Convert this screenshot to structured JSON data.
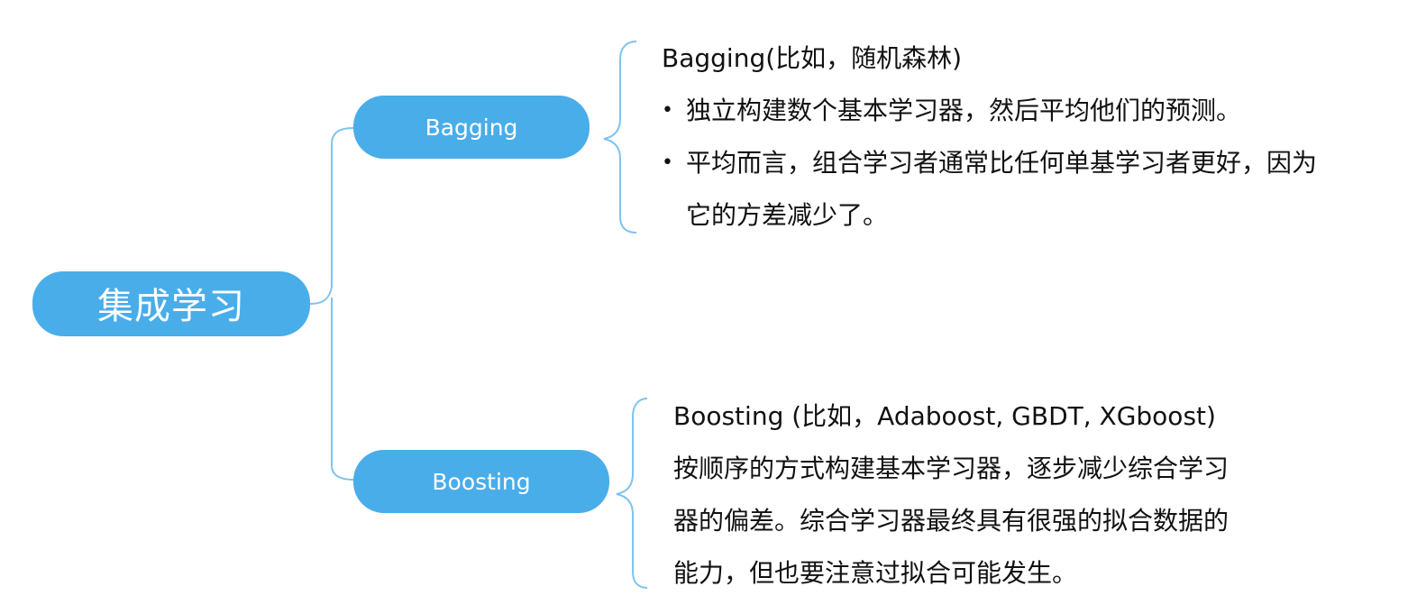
{
  "root": {
    "label": "集成学习"
  },
  "bagging": {
    "label": "Bagging",
    "title": "Bagging(比如，随机森林)",
    "bullets": [
      {
        "lines": [
          "独立构建数个基本学习器，然后平均他们的预测。"
        ]
      },
      {
        "lines": [
          "平均而言，组合学习者通常比任何单基学习者更好，因为",
          "它的方差减少了。"
        ]
      }
    ]
  },
  "boosting": {
    "label": "Boosting",
    "title": "Boosting (比如，Adaboost, GBDT, XGboost)",
    "lines": [
      "按顺序的方式构建基本学习器，逐步减少综合学习",
      "器的偏差。综合学习器最终具有很强的拟合数据的",
      "能力，但也要注意过拟合可能发生。"
    ]
  },
  "colors": {
    "node_fill": "#49ade9",
    "node_text": "#ffffff",
    "connector": "#7fc3ef",
    "body_text": "#111111"
  }
}
